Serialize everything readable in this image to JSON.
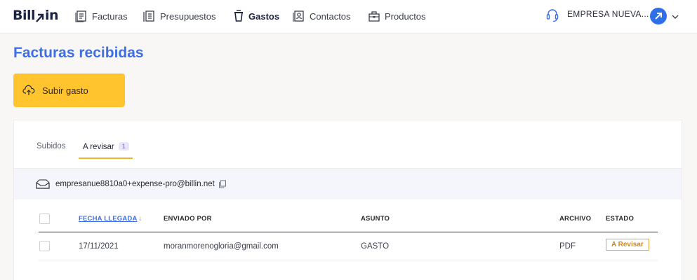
{
  "brand": {
    "logo_text_left": "Bill",
    "logo_text_right": "in"
  },
  "nav": {
    "items": [
      {
        "label": "Facturas",
        "icon": "invoice-icon"
      },
      {
        "label": "Presupuestos",
        "icon": "budget-icon"
      },
      {
        "label": "Gastos",
        "icon": "expense-cup-icon",
        "active": true
      },
      {
        "label": "Contactos",
        "icon": "contacts-icon"
      },
      {
        "label": "Productos",
        "icon": "products-icon"
      }
    ],
    "company_name": "EMPRESA NUEVA...",
    "support_icon": "headset-icon",
    "avatar_icon": "arrow-up-right-icon"
  },
  "page": {
    "title": "Facturas recibidas",
    "upload_label": "Subir gasto"
  },
  "tabs": {
    "items": [
      {
        "label": "Subidos"
      },
      {
        "label": "A revisar",
        "badge": "1",
        "active": true
      }
    ]
  },
  "inbox": {
    "email": "empresanue8810a0+expense-pro@billin.net"
  },
  "table": {
    "headers": {
      "date": "FECHA LLEGADA",
      "sender": "ENVIADO POR",
      "subject": "ASUNTO",
      "file": "ARCHIVO",
      "status": "ESTADO"
    },
    "rows": [
      {
        "date": "17/11/2021",
        "sender": "moranmorenogloria@gmail.com",
        "subject": "GASTO",
        "file": "PDF",
        "status": "A Revisar"
      }
    ]
  },
  "colors": {
    "accent_blue": "#3f6fe6",
    "upload_yellow": "#ffc42e",
    "tab_underline": "#f1b52a",
    "status_orange": "#d08a1a"
  }
}
